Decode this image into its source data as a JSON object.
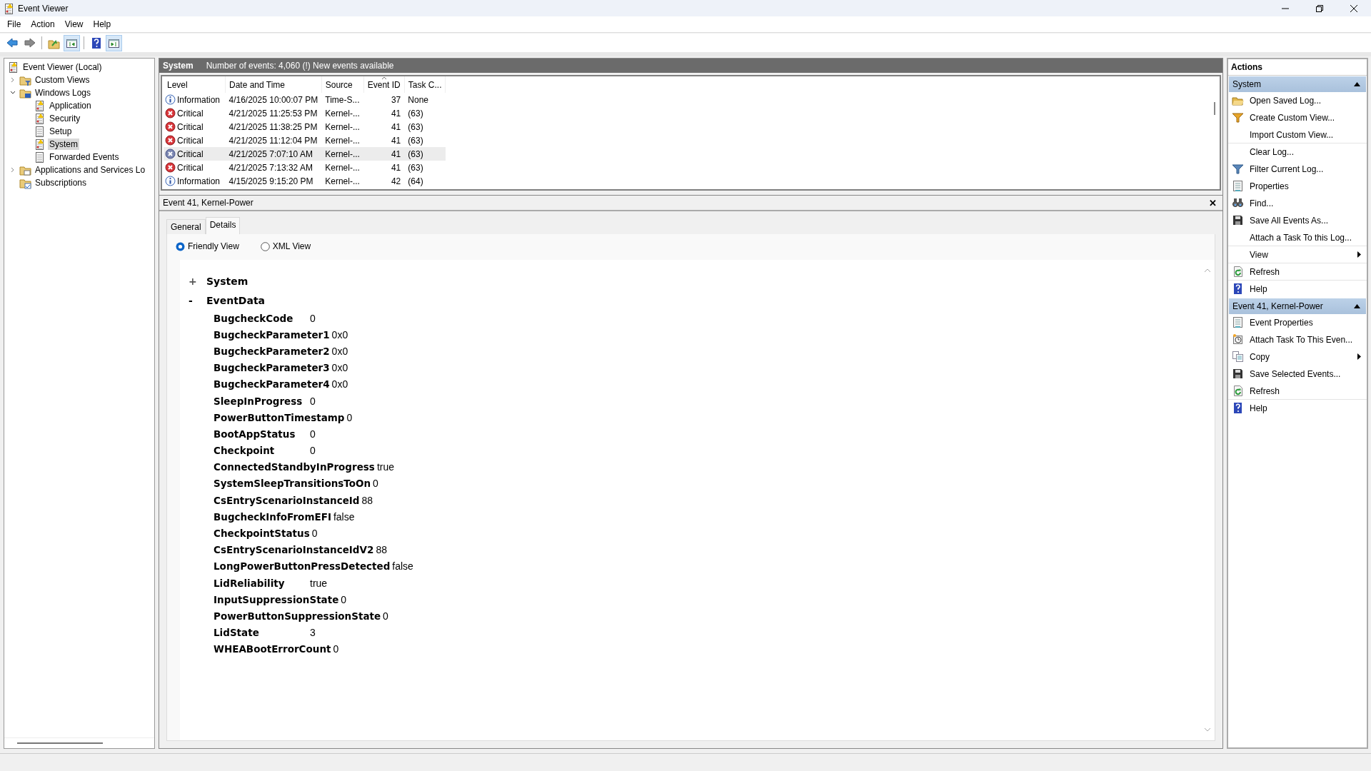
{
  "window": {
    "title": "Event Viewer"
  },
  "menu": [
    "File",
    "Action",
    "View",
    "Help"
  ],
  "toolbar": [
    {
      "kind": "back",
      "pressed": false
    },
    {
      "kind": "forward",
      "pressed": false
    },
    {
      "kind": "separator"
    },
    {
      "kind": "up",
      "pressed": false
    },
    {
      "kind": "tree",
      "pressed": true
    },
    {
      "kind": "separator"
    },
    {
      "kind": "help",
      "pressed": false
    },
    {
      "kind": "pane",
      "pressed": true
    }
  ],
  "tree": [
    {
      "label": "Event Viewer (Local)",
      "kind": "root",
      "selected": false,
      "children": [
        {
          "label": "Custom Views",
          "kind": "views",
          "expanded": false,
          "selected": false
        },
        {
          "label": "Windows Logs",
          "kind": "logs",
          "expanded": true,
          "selected": false,
          "children": [
            {
              "label": "Application",
              "kind": "alert",
              "selected": false
            },
            {
              "label": "Security",
              "kind": "alert",
              "selected": false
            },
            {
              "label": "Setup",
              "kind": "log",
              "selected": false
            },
            {
              "label": "System",
              "kind": "alert",
              "selected": true
            },
            {
              "label": "Forwarded Events",
              "kind": "log",
              "selected": false
            }
          ]
        },
        {
          "label": "Applications and Services Lo",
          "kind": "folder",
          "expanded": false,
          "selected": false
        },
        {
          "label": "Subscriptions",
          "kind": "subscriptions",
          "selected": false
        }
      ]
    }
  ],
  "log": {
    "name": "System",
    "summary": "Number of events: 4,060 (!) New events available"
  },
  "events": {
    "columns": [
      {
        "label": "Level",
        "sorted": false
      },
      {
        "label": "Date and Time",
        "sorted": false
      },
      {
        "label": "Source",
        "sorted": false
      },
      {
        "label": "Event ID",
        "sorted": true
      },
      {
        "label": "Task C...",
        "sorted": false
      }
    ],
    "rows": [
      {
        "kind": "information",
        "level": "Information",
        "date": "4/16/2025 10:00:07 PM",
        "source": "Time-S...",
        "id": "37",
        "task": "None",
        "selected": false
      },
      {
        "kind": "critical",
        "level": "Critical",
        "date": "4/21/2025 11:25:53 PM",
        "source": "Kernel-...",
        "id": "41",
        "task": "(63)",
        "selected": false
      },
      {
        "kind": "critical",
        "level": "Critical",
        "date": "4/21/2025 11:38:25 PM",
        "source": "Kernel-...",
        "id": "41",
        "task": "(63)",
        "selected": false
      },
      {
        "kind": "critical",
        "level": "Critical",
        "date": "4/21/2025 11:12:04 PM",
        "source": "Kernel-...",
        "id": "41",
        "task": "(63)",
        "selected": false
      },
      {
        "kind": "critical",
        "level": "Critical",
        "date": "4/21/2025 7:07:10 AM",
        "source": "Kernel-...",
        "id": "41",
        "task": "(63)",
        "selected": true
      },
      {
        "kind": "critical",
        "level": "Critical",
        "date": "4/21/2025 7:13:32 AM",
        "source": "Kernel-...",
        "id": "41",
        "task": "(63)",
        "selected": false
      },
      {
        "kind": "information",
        "level": "Information",
        "date": "4/15/2025 9:15:20 PM",
        "source": "Kernel-...",
        "id": "42",
        "task": "(64)",
        "selected": false
      }
    ]
  },
  "details": {
    "title": "Event 41, Kernel-Power",
    "close": "✕",
    "tabs": [
      {
        "label": "General",
        "selected": false
      },
      {
        "label": "Details",
        "selected": true
      }
    ],
    "views": [
      {
        "label": "Friendly View",
        "selected": true
      },
      {
        "label": "XML View",
        "selected": false
      }
    ],
    "sections": [
      {
        "toggle": "+",
        "name": "System",
        "expanded": false
      },
      {
        "toggle": "-",
        "name": "EventData",
        "expanded": true,
        "fields": [
          {
            "name": "BugcheckCode",
            "value": "0"
          },
          {
            "name": "BugcheckParameter1",
            "value": "0x0"
          },
          {
            "name": "BugcheckParameter2",
            "value": "0x0"
          },
          {
            "name": "BugcheckParameter3",
            "value": "0x0"
          },
          {
            "name": "BugcheckParameter4",
            "value": "0x0"
          },
          {
            "name": "SleepInProgress",
            "value": "0"
          },
          {
            "name": "PowerButtonTimestamp",
            "value": "0"
          },
          {
            "name": "BootAppStatus",
            "value": "0"
          },
          {
            "name": "Checkpoint",
            "value": "0"
          },
          {
            "name": "ConnectedStandbyInProgress",
            "value": "true"
          },
          {
            "name": "SystemSleepTransitionsToOn",
            "value": "0"
          },
          {
            "name": "CsEntryScenarioInstanceId",
            "value": "88"
          },
          {
            "name": "BugcheckInfoFromEFI",
            "value": "false"
          },
          {
            "name": "CheckpointStatus",
            "value": "0"
          },
          {
            "name": "CsEntryScenarioInstanceIdV2",
            "value": "88"
          },
          {
            "name": "LongPowerButtonPressDetected",
            "value": "false"
          },
          {
            "name": "LidReliability",
            "value": "true"
          },
          {
            "name": "InputSuppressionState",
            "value": "0"
          },
          {
            "name": "PowerButtonSuppressionState",
            "value": "0"
          },
          {
            "name": "LidState",
            "value": "3"
          },
          {
            "name": "WHEABootErrorCount",
            "value": "0"
          }
        ]
      }
    ]
  },
  "actions": {
    "title": "Actions",
    "groups": [
      {
        "title": "System",
        "expanded": true,
        "items": [
          {
            "label": "Open Saved Log...",
            "kind": "open",
            "submenu": false,
            "divider": false
          },
          {
            "label": "Create Custom View...",
            "kind": "create-view",
            "submenu": false,
            "divider": false
          },
          {
            "label": "Import Custom View...",
            "kind": "plain",
            "submenu": false,
            "divider": true
          },
          {
            "label": "Clear Log...",
            "kind": "plain",
            "submenu": false,
            "divider": false
          },
          {
            "label": "Filter Current Log...",
            "kind": "filter",
            "submenu": false,
            "divider": false
          },
          {
            "label": "Properties",
            "kind": "properties",
            "submenu": false,
            "divider": false
          },
          {
            "label": "Find...",
            "kind": "find",
            "submenu": false,
            "divider": false
          },
          {
            "label": "Save All Events As...",
            "kind": "save",
            "submenu": false,
            "divider": false
          },
          {
            "label": "Attach a Task To this Log...",
            "kind": "plain",
            "submenu": false,
            "divider": true
          },
          {
            "label": "View",
            "kind": "plain",
            "submenu": true,
            "divider": true
          },
          {
            "label": "Refresh",
            "kind": "refresh",
            "submenu": false,
            "divider": true
          },
          {
            "label": "Help",
            "kind": "help",
            "submenu": false,
            "divider": false
          }
        ]
      },
      {
        "title": "Event 41, Kernel-Power",
        "expanded": true,
        "items": [
          {
            "label": "Event Properties",
            "kind": "properties",
            "submenu": false,
            "divider": false
          },
          {
            "label": "Attach Task To This Even...",
            "kind": "task",
            "submenu": false,
            "divider": false
          },
          {
            "label": "Copy",
            "kind": "copy",
            "submenu": true,
            "divider": false
          },
          {
            "label": "Save Selected Events...",
            "kind": "save",
            "submenu": false,
            "divider": false
          },
          {
            "label": "Refresh",
            "kind": "refresh",
            "submenu": false,
            "divider": true
          },
          {
            "label": "Help",
            "kind": "help",
            "submenu": false,
            "divider": false
          }
        ]
      }
    ]
  }
}
